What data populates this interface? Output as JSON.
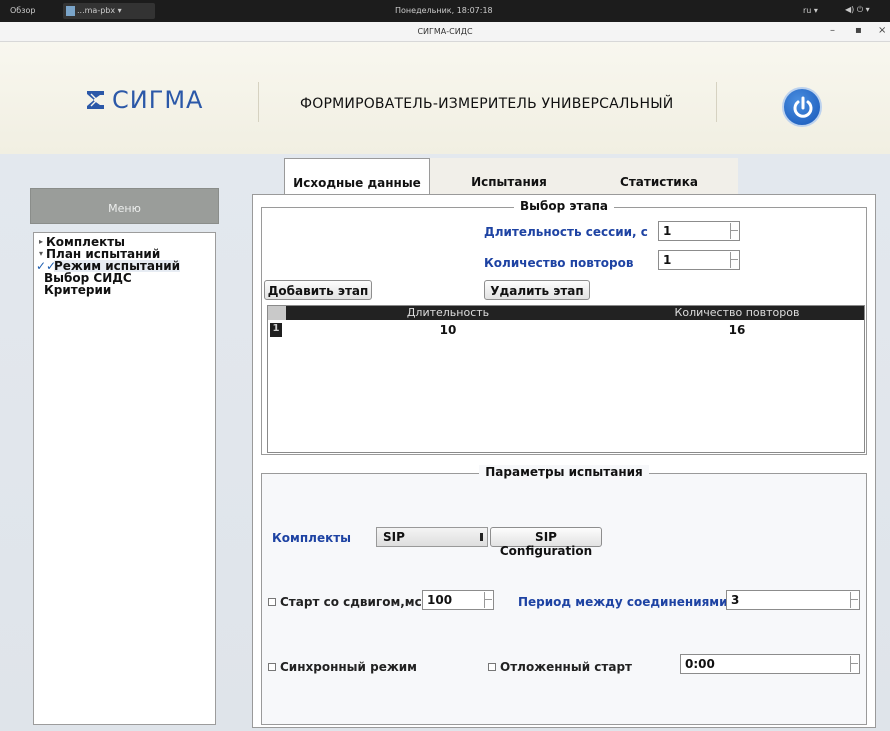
{
  "os_bar": {
    "overview_label": "Обзор",
    "app_label": "...ma-pbx ▾",
    "clock": "Понедельник, 18:07:18",
    "lang": "ru ▾",
    "status_icons": "◀) ⏻ ▾"
  },
  "window": {
    "title": "СИГМА-СИДС",
    "minimize": "–",
    "maximize": "▪",
    "close": "×"
  },
  "header": {
    "logo_text": "СИГМА",
    "product_title": "ФОРМИРОВАТЕЛЬ-ИЗМЕРИТЕЛЬ УНИВЕРСАЛЬНЫЙ",
    "power_icon": "power-icon",
    "accent": "#2b58a8"
  },
  "sidebar": {
    "menu_title": "Меню",
    "items": [
      {
        "label": "Комплекты",
        "marker": "▸"
      },
      {
        "label": "План испытаний",
        "marker": "▾"
      },
      {
        "label": "Режим испытаний",
        "marker": "✓✓"
      },
      {
        "label": "Выбор СИДС",
        "marker": ""
      },
      {
        "label": "Критерии",
        "marker": ""
      }
    ]
  },
  "tabs": [
    {
      "label": "Исходные данные",
      "active": true
    },
    {
      "label": "Испытания",
      "active": false
    },
    {
      "label": "Статистика",
      "active": false
    }
  ],
  "stage_group": {
    "title": "Выбор этапа",
    "duration_label": "Длительность сессии, с",
    "duration_value": "1",
    "repeats_label": "Количество повторов",
    "repeats_value": "1",
    "add_button": "Добавить этап",
    "delete_button": "Удалить этап",
    "table": {
      "columns": [
        "Длительность",
        "Количество повторов"
      ],
      "rows": [
        {
          "n": "1",
          "duration": "10",
          "repeats": "16"
        }
      ]
    }
  },
  "params_group": {
    "title": "Параметры испытания",
    "kits_label": "Комплекты",
    "kits_value": "SIP",
    "config_button": "SIP Configuration",
    "shift_start_label": "Старт со сдвигом,мс",
    "shift_start_value": "100",
    "period_label": "Период между соединениями,с",
    "period_value": "3",
    "sync_label": "Синхронный режим",
    "delayed_label": "Отложенный старт",
    "delayed_value": "0:00"
  }
}
